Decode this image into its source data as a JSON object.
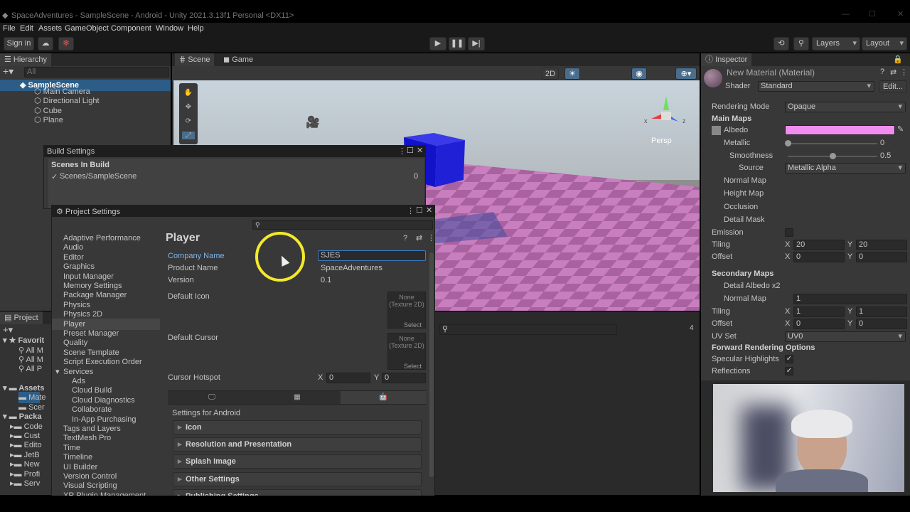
{
  "window": {
    "title": "SpaceAdventures - SampleScene - Android - Unity 2021.3.13f1 Personal <DX11>"
  },
  "menu": [
    "File",
    "Edit",
    "Assets",
    "GameObject",
    "Component",
    "Window",
    "Help"
  ],
  "toolbar": {
    "signin": "Sign in",
    "layers": "Layers",
    "layout": "Layout"
  },
  "hierarchy": {
    "tab": "Hierarchy",
    "search_placeholder": "All",
    "scene": "SampleScene",
    "items": [
      "Main Camera",
      "Directional Light",
      "Cube",
      "Plane"
    ]
  },
  "sceneview": {
    "tab_scene": "Scene",
    "tab_game": "Game",
    "mode_2d": "2D",
    "persp": "Persp",
    "x_axis": "x",
    "z_axis": "z",
    "layer_count": "4"
  },
  "build_settings": {
    "title": "Build Settings",
    "header": "Scenes In Build",
    "scene": "Scenes/SampleScene",
    "index": "0"
  },
  "project_settings": {
    "title": "Project Settings",
    "nav": [
      "Adaptive Performance",
      "Audio",
      "Editor",
      "Graphics",
      "Input Manager",
      "Memory Settings",
      "Package Manager",
      "Physics",
      "Physics 2D",
      "Player",
      "Preset Manager",
      "Quality",
      "Scene Template",
      "Script Execution Order",
      "Services",
      "Ads",
      "Cloud Build",
      "Cloud Diagnostics",
      "Collaborate",
      "In-App Purchasing",
      "Tags and Layers",
      "TextMesh Pro",
      "Time",
      "Timeline",
      "UI Builder",
      "Version Control",
      "Visual Scripting",
      "XR Plugin Management"
    ],
    "selected": "Player",
    "player": {
      "heading": "Player",
      "company_label": "Company Name",
      "company_value": "SJES",
      "product_label": "Product Name",
      "product_value": "SpaceAdventures",
      "version_label": "Version",
      "version_value": "0.1",
      "icon_label": "Default Icon",
      "cursor_label": "Default Cursor",
      "none_texture": "None\n(Texture 2D)",
      "select": "Select",
      "hotspot_label": "Cursor Hotspot",
      "hotspot_x_label": "X",
      "hotspot_x": "0",
      "hotspot_y_label": "Y",
      "hotspot_y": "0",
      "platform_heading": "Settings for Android",
      "sections": [
        "Icon",
        "Resolution and Presentation",
        "Splash Image",
        "Other Settings",
        "Publishing Settings"
      ]
    }
  },
  "project": {
    "tab": "Project",
    "favorites": "Favorit",
    "fav_items": [
      "All M",
      "All M",
      "All P"
    ],
    "assets": "Assets",
    "asset_items": [
      "Mate",
      "Scer"
    ],
    "packages": "Packa",
    "package_items": [
      "Code",
      "Cust",
      "Edito",
      "JetB",
      "New",
      "Profi",
      "Serv"
    ]
  },
  "inspector": {
    "tab": "Inspector",
    "material_name": "New Material (Material)",
    "shader_label": "Shader",
    "shader_value": "Standard",
    "edit": "Edit...",
    "rendering_mode_label": "Rendering Mode",
    "rendering_mode_value": "Opaque",
    "main_maps": "Main Maps",
    "albedo": "Albedo",
    "albedo_color": "#f08ef0",
    "metallic": "Metallic",
    "metallic_value": "0",
    "metallic_level": 0.0,
    "smoothness": "Smoothness",
    "smoothness_value": "0.5",
    "smoothness_level": 0.5,
    "source_label": "Source",
    "source_value": "Metallic Alpha",
    "normal_map": "Normal Map",
    "height_map": "Height Map",
    "occlusion": "Occlusion",
    "detail_mask": "Detail Mask",
    "emission": "Emission",
    "tiling": "Tiling",
    "offset": "Offset",
    "x": "X",
    "y": "Y",
    "main_tiling_x": "20",
    "main_tiling_y": "20",
    "main_offset_x": "0",
    "main_offset_y": "0",
    "secondary_maps": "Secondary Maps",
    "detail_albedo": "Detail Albedo x2",
    "detail_normal": "Normal Map",
    "detail_normal_value": "1",
    "sec_tiling_x": "1",
    "sec_tiling_y": "1",
    "sec_offset_x": "0",
    "sec_offset_y": "0",
    "uv_set_label": "UV Set",
    "uv_set_value": "UV0",
    "forward_options": "Forward Rendering Options",
    "specular": "Specular Highlights",
    "reflections": "Reflections",
    "check": "✓"
  }
}
